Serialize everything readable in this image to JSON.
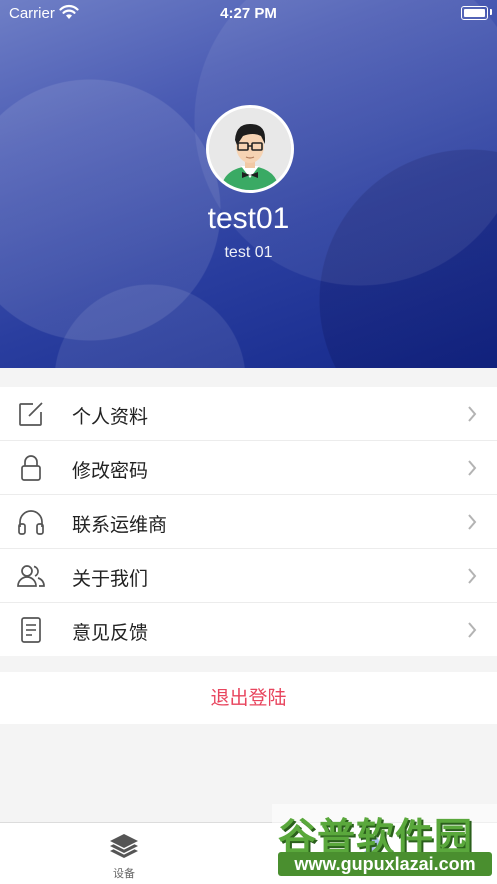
{
  "status_bar": {
    "carrier": "Carrier",
    "time": "4:27 PM",
    "battery_level": 1.0
  },
  "profile": {
    "name": "test01",
    "account": "test 01"
  },
  "menu": {
    "items": [
      {
        "label": "个人资料",
        "icon": "edit-icon"
      },
      {
        "label": "修改密码",
        "icon": "lock-icon"
      },
      {
        "label": "联系运维商",
        "icon": "headset-icon"
      },
      {
        "label": "关于我们",
        "icon": "users-icon"
      },
      {
        "label": "意见反馈",
        "icon": "document-icon"
      }
    ]
  },
  "logout": {
    "label": "退出登陆",
    "color": "#e8455e"
  },
  "tab_bar": {
    "tabs": [
      {
        "label": "设备",
        "icon": "layers-icon"
      },
      {
        "label": "",
        "icon": "user-icon"
      }
    ]
  },
  "watermark": {
    "brand": "谷普软件园",
    "url": "www.gupuxlazai.com"
  }
}
